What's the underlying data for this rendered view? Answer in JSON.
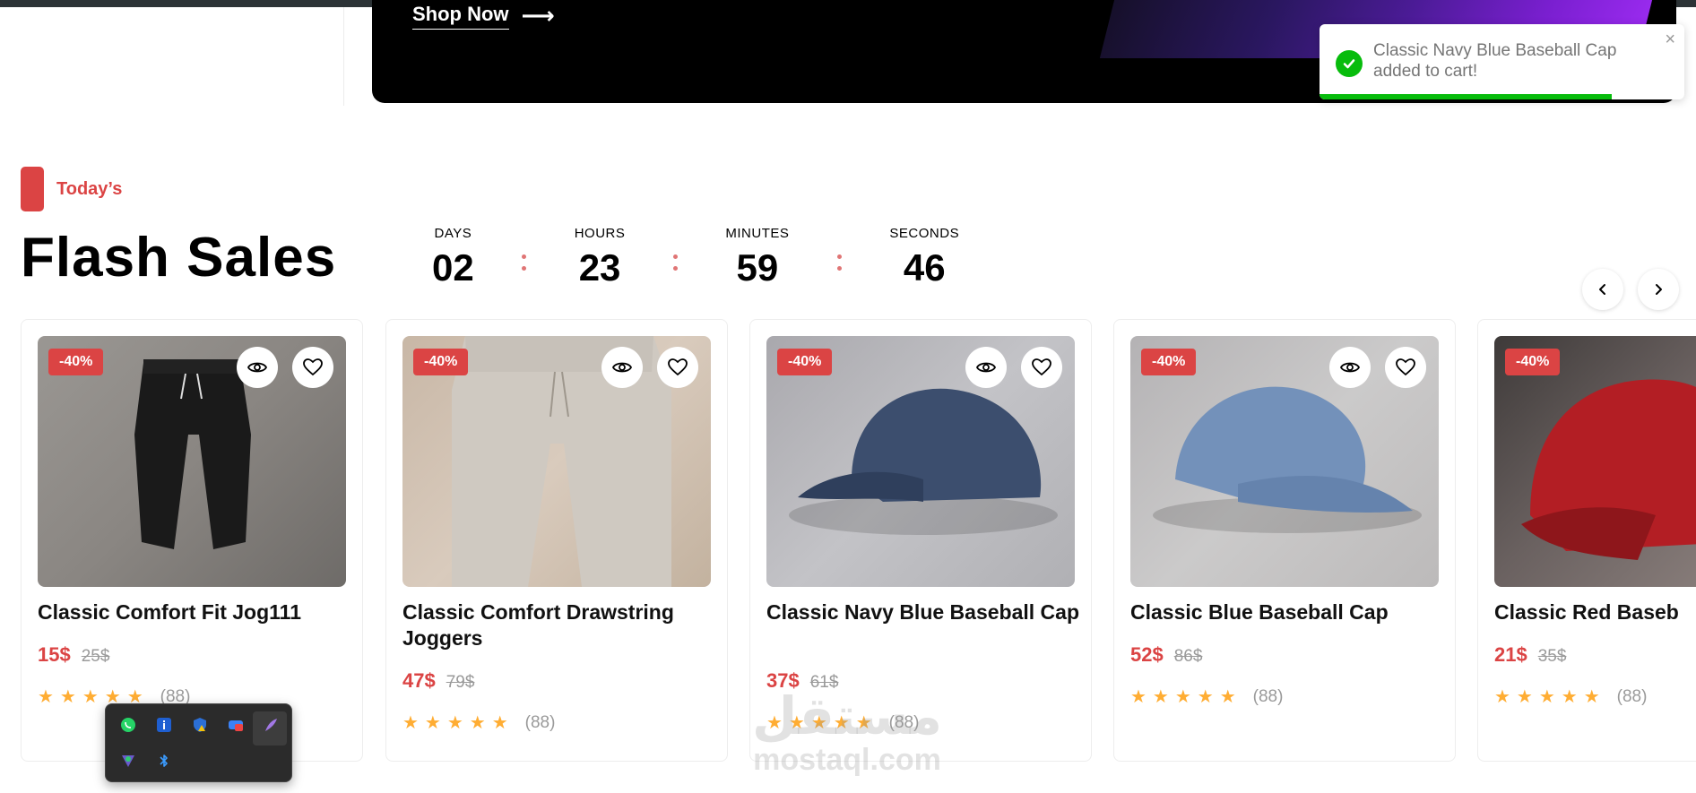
{
  "hero": {
    "cta_label": "Shop Now",
    "cta_arrow": "⟶"
  },
  "toast": {
    "message": "Classic Navy Blue Baseball Cap added to cart!",
    "close_icon": "×",
    "progress": 0.8,
    "color": "#07bc0c"
  },
  "section": {
    "tag": "Today’s",
    "title": "Flash Sales",
    "accent_color": "#db4444"
  },
  "countdown": {
    "days_label": "DAYS",
    "days": "02",
    "hours_label": "HOURS",
    "hours": "23",
    "minutes_label": "MINUTES",
    "minutes": "59",
    "seconds_label": "SECONDS",
    "seconds": "46"
  },
  "navigation": {
    "prev_icon": "chevron-left-icon",
    "next_icon": "chevron-right-icon"
  },
  "products": [
    {
      "badge": "-40%",
      "title": "Classic Comfort Fit Jog111",
      "price": "15$",
      "old_price": "25$",
      "stars": "★★★★★",
      "reviews": "(88)"
    },
    {
      "badge": "-40%",
      "title": "Classic Comfort Drawstring Joggers",
      "price": "47$",
      "old_price": "79$",
      "stars": "★★★★★",
      "reviews": "(88)"
    },
    {
      "badge": "-40%",
      "title": "Classic Navy Blue Baseball Cap",
      "price": "37$",
      "old_price": "61$",
      "stars": "★★★★★",
      "reviews": "(88)"
    },
    {
      "badge": "-40%",
      "title": "Classic Blue Baseball Cap",
      "price": "52$",
      "old_price": "86$",
      "stars": "★★★★★",
      "reviews": "(88)"
    },
    {
      "badge": "-40%",
      "title": "Classic Red Baseb",
      "price": "21$",
      "old_price": "35$",
      "stars": "★★★★★",
      "reviews": "(88)"
    }
  ],
  "tray": {
    "icons": [
      "whatsapp-icon",
      "info-icon",
      "shield-warning-icon",
      "cloud-icon",
      "feather-icon",
      "vpn-icon",
      "bluetooth-icon"
    ]
  },
  "watermark": {
    "arabic": "مستقل",
    "latin": "mostaql.com"
  }
}
